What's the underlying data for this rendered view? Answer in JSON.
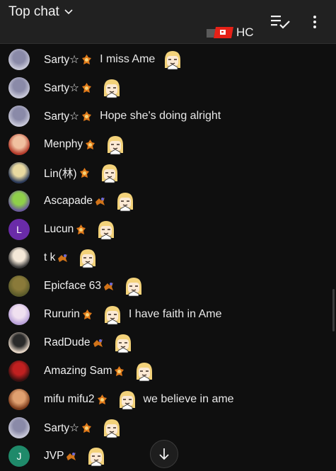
{
  "header": {
    "title": "Top chat",
    "membership_label": "HC"
  },
  "colors": {
    "background": "#0f0f0f",
    "header_bg": "#212121",
    "text": "#f1f1f1",
    "membership_red": "#e62117"
  },
  "icons": {
    "title_chevron": "chevron-down-icon",
    "filter": "playlist-check-icon",
    "more": "more-vertical-icon",
    "membership": "membership-badge-icon",
    "scroll_down": "arrow-down-icon",
    "member_badge": "member-badge-icon",
    "emote": "character-emote-icon"
  },
  "messages": [
    {
      "author": "Sarty☆",
      "badge": "member-badge-icon",
      "emote_position": "after-text",
      "emotes": 1,
      "text": "I miss Ame",
      "avatar": "silver"
    },
    {
      "author": "Sarty☆",
      "badge": "member-badge-icon",
      "emote_position": "only",
      "emotes": 1,
      "text": "",
      "avatar": "silver"
    },
    {
      "author": "Sarty☆",
      "badge": "member-badge-icon",
      "emote_position": "none",
      "emotes": 0,
      "text": "Hope she's doing alright",
      "avatar": "silver"
    },
    {
      "author": "Menphy",
      "badge": "member-badge-icon",
      "emote_position": "only",
      "emotes": 1,
      "text": "",
      "avatar": "red"
    },
    {
      "author": "Lin(林)",
      "badge": "member-badge-icon",
      "emote_position": "only",
      "emotes": 1,
      "text": "",
      "avatar": "blonde"
    },
    {
      "author": "Ascapade",
      "badge": "gift-badge-icon",
      "emote_position": "only",
      "emotes": 1,
      "text": "",
      "avatar": "purple-char"
    },
    {
      "author": "Lucun",
      "badge": "member-badge-icon",
      "emote_position": "only",
      "emotes": 1,
      "text": "",
      "avatar": "letter",
      "avatar_letter": "L"
    },
    {
      "author": "t k",
      "badge": "gift-badge-icon",
      "emote_position": "only",
      "emotes": 1,
      "text": "",
      "avatar": "anime-face"
    },
    {
      "author": "Epicface 63",
      "badge": "gift-badge-icon",
      "emote_position": "only",
      "emotes": 1,
      "text": "",
      "avatar": "olive"
    },
    {
      "author": "Rururin",
      "badge": "member-badge-icon",
      "emote_position": "before-text",
      "emotes": 1,
      "text": "I have faith in Ame",
      "avatar": "lilac"
    },
    {
      "author": "RadDude",
      "badge": "gift-badge-icon",
      "emote_position": "only",
      "emotes": 1,
      "text": "",
      "avatar": "sunglasses"
    },
    {
      "author": "Amazing Sam",
      "badge": "member-badge-icon",
      "emote_position": "only",
      "emotes": 1,
      "text": "",
      "avatar": "dark-red"
    },
    {
      "author": "mifu mifu2",
      "badge": "member-badge-icon",
      "emote_position": "before-text",
      "emotes": 1,
      "text": "we believe in ame",
      "avatar": "brown"
    },
    {
      "author": "Sarty☆",
      "badge": "member-badge-icon",
      "emote_position": "only",
      "emotes": 1,
      "text": "",
      "avatar": "silver"
    },
    {
      "author": "JVP",
      "badge": "gift-badge-icon",
      "emote_position": "only",
      "emotes": 1,
      "text": "",
      "avatar": "letter",
      "avatar_letter": "J"
    }
  ]
}
